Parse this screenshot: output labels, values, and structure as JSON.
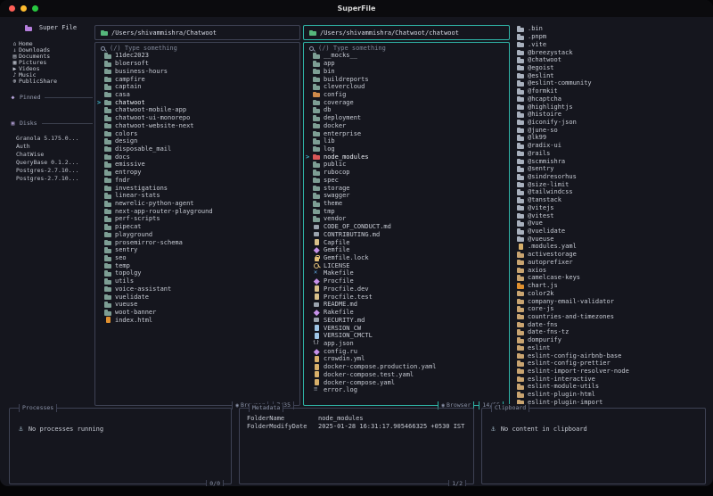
{
  "window": {
    "title": "SuperFile"
  },
  "colors": {
    "accent_teal": "#2fb3a6",
    "border_gray": "#3e4254",
    "cursor_cyan": "#3fb6c9",
    "folder_default": "#7d9e94",
    "folder_red": "#d95757",
    "folder_orange": "#cf8a4a",
    "folder_tan": "#c9a470",
    "folder_gray": "#a8b0bd",
    "traffic_red": "#ff5f57",
    "traffic_yellow": "#febc2e",
    "traffic_green": "#28c840"
  },
  "sidebar": {
    "title": "Super File",
    "items": [
      {
        "label": "Home",
        "icon": "home"
      },
      {
        "label": "Downloads",
        "icon": "downloads"
      },
      {
        "label": "Documents",
        "icon": "documents"
      },
      {
        "label": "Pictures",
        "icon": "pictures"
      },
      {
        "label": "Videos",
        "icon": "videos"
      },
      {
        "label": "Music",
        "icon": "music"
      },
      {
        "label": "PublicShare",
        "icon": "publicshare"
      }
    ],
    "pinned_label": "Pinned",
    "disks_label": "Disks",
    "disks": [
      "Granola 5.175.0...",
      "Auth",
      "ChatWise",
      "QueryBase 0.1.2...",
      "Postgres-2.7.10...",
      "Postgres-2.7.10..."
    ]
  },
  "panels": [
    {
      "path": "/Users/shivammishra/Chatwoot",
      "search_placeholder": "(/) Type something",
      "footer_label": "Browser",
      "footer_count": "7/35",
      "items": [
        "11dec2023",
        "bloersoft",
        "business-hours",
        "campfire",
        "captain",
        "casa",
        {
          "label": "chatwoot",
          "selected": true
        },
        "chatwoot-mobile-app",
        "chatwoot-ui-monorepo",
        "chatwoot-website-next",
        "colors",
        "design",
        "disposable_mail",
        "docs",
        "emissive",
        "entropy",
        "fndr",
        "investigations",
        "linear-stats",
        "newrelic-python-agent",
        "next-app-router-playground",
        "perf-scripts",
        "pipecat",
        "playground",
        "prosemirror-schema",
        "sentry",
        "seo",
        "temp",
        "topolgy",
        "utils",
        "voice-assistant",
        "vuelidate",
        "vueuse",
        "woot-banner",
        {
          "label": "index.html",
          "icon": "html"
        }
      ]
    },
    {
      "path": "/Users/shivammishra/Chatwoot/chatwoot",
      "search_placeholder": "(/) Type something",
      "footer_label": "Browser",
      "footer_count": "14/55",
      "items": [
        "__mocks__",
        "app",
        "bin",
        "buildreports",
        "clevercloud",
        {
          "label": "config",
          "color": "#cf8a4a"
        },
        "coverage",
        "db",
        "deployment",
        "docker",
        "enterprise",
        "lib",
        "log",
        {
          "label": "node_modules",
          "color": "#d95757",
          "selected": true
        },
        "public",
        "rubocop",
        "spec",
        "storage",
        "swagger",
        "theme",
        "tmp",
        "vendor",
        {
          "label": "CODE_OF_CONDUCT.md",
          "icon": "md"
        },
        {
          "label": "CONTRIBUTING.md",
          "icon": "md"
        },
        {
          "label": "Capfile",
          "icon": "file",
          "color": "#d8c08a"
        },
        {
          "label": "Gemfile",
          "icon": "gem"
        },
        {
          "label": "Gemfile.lock",
          "icon": "lock"
        },
        {
          "label": "LICENSE",
          "icon": "key"
        },
        {
          "label": "Makefile",
          "icon": "make"
        },
        {
          "label": "Procfile",
          "icon": "gem"
        },
        {
          "label": "Procfile.dev",
          "icon": "file",
          "color": "#d8c08a"
        },
        {
          "label": "Procfile.test",
          "icon": "file",
          "color": "#d8c08a"
        },
        {
          "label": "README.md",
          "icon": "md"
        },
        {
          "label": "Rakefile",
          "icon": "gem"
        },
        {
          "label": "SECURITY.md",
          "icon": "md"
        },
        {
          "label": "VERSION_CW",
          "icon": "file",
          "color": "#9fc6e8"
        },
        {
          "label": "VERSION_CMCTL",
          "icon": "file",
          "color": "#9fc6e8"
        },
        {
          "label": "app.json",
          "icon": "braces"
        },
        {
          "label": "config.ru",
          "icon": "gem"
        },
        {
          "label": "crowdin.yml",
          "icon": "yaml"
        },
        {
          "label": "docker-compose.production.yaml",
          "icon": "yaml"
        },
        {
          "label": "docker-compose.test.yaml",
          "icon": "yaml"
        },
        {
          "label": "docker-compose.yaml",
          "icon": "yaml"
        },
        {
          "label": "error.log",
          "icon": "log"
        }
      ]
    }
  ],
  "preview": {
    "items": [
      ".bin",
      ".pnpm",
      ".vite",
      "@breezystack",
      "@chatwoot",
      "@egoist",
      "@eslint",
      "@eslint-community",
      "@formkit",
      "@hcaptcha",
      "@highlightjs",
      "@histoire",
      "@iconify-json",
      "@june-so",
      "@lk99",
      "@radix-ui",
      "@rails",
      "@scmmishra",
      "@sentry",
      "@sindresorhus",
      "@size-limit",
      "@tailwindcss",
      "@tanstack",
      "@vitejs",
      "@vitest",
      "@vue",
      "@vuelidate",
      "@vueuse",
      {
        "label": ".modules.yaml",
        "icon": "yaml"
      },
      {
        "label": "activestorage",
        "color": "#c9a470"
      },
      {
        "label": "autoprefixer",
        "color": "#c9a470"
      },
      {
        "label": "axios",
        "color": "#c9a470"
      },
      {
        "label": "camelcase-keys",
        "color": "#c9a470"
      },
      {
        "label": "chart.js",
        "color": "#e0902f"
      },
      {
        "label": "color2k",
        "color": "#c9a470"
      },
      {
        "label": "company-email-validator",
        "color": "#c9a470"
      },
      {
        "label": "core-js",
        "color": "#c9a470"
      },
      {
        "label": "countries-and-timezones",
        "color": "#c9a470"
      },
      {
        "label": "date-fns",
        "color": "#c9a470"
      },
      {
        "label": "date-fns-tz",
        "color": "#c9a470"
      },
      {
        "label": "dompurify",
        "color": "#c9a470"
      },
      {
        "label": "eslint",
        "color": "#c9a470"
      },
      {
        "label": "eslint-config-airbnb-base",
        "color": "#c9a470"
      },
      {
        "label": "eslint-config-prettier",
        "color": "#c9a470"
      },
      {
        "label": "eslint-import-resolver-node",
        "color": "#c9a470"
      },
      {
        "label": "eslint-interactive",
        "color": "#c9a470"
      },
      {
        "label": "eslint-module-utils",
        "color": "#c9a470"
      },
      {
        "label": "eslint-plugin-html",
        "color": "#c9a470"
      },
      {
        "label": "eslint-plugin-import",
        "color": "#c9a470"
      }
    ]
  },
  "bottom": {
    "processes": {
      "title": "Processes",
      "empty_text": "No processes running",
      "counter": "0/0"
    },
    "metadata": {
      "title": "Metadata",
      "rows": [
        [
          "FolderName",
          "node_modules"
        ],
        [
          "FolderModifyDate",
          "2025-01-28 16:31:17.905466325 +0530 IST"
        ]
      ],
      "counter": "1/2"
    },
    "clipboard": {
      "title": "Clipboard",
      "empty_text": "No content in clipboard"
    }
  }
}
